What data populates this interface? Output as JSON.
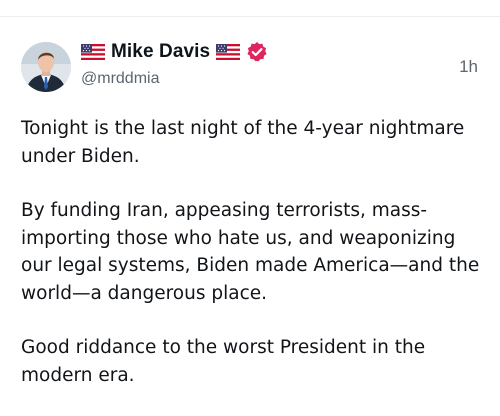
{
  "author": {
    "display_name": "Mike Davis",
    "handle": "@mrddmia",
    "leading_badge_icon": "us-flag-icon",
    "trailing_badge_icon": "us-flag-icon",
    "verified_icon": "verified-badge-icon",
    "verified_color": "#e0245e"
  },
  "post": {
    "timestamp": "1h",
    "paragraphs": [
      "Tonight is the last night of the 4-year nightmare under Biden.",
      "By funding Iran, appeasing terrorists, mass-importing those who hate us, and weaponizing our legal systems, Biden made America—and the world—a dangerous place.",
      "Good riddance to the worst President in the modern era."
    ]
  }
}
